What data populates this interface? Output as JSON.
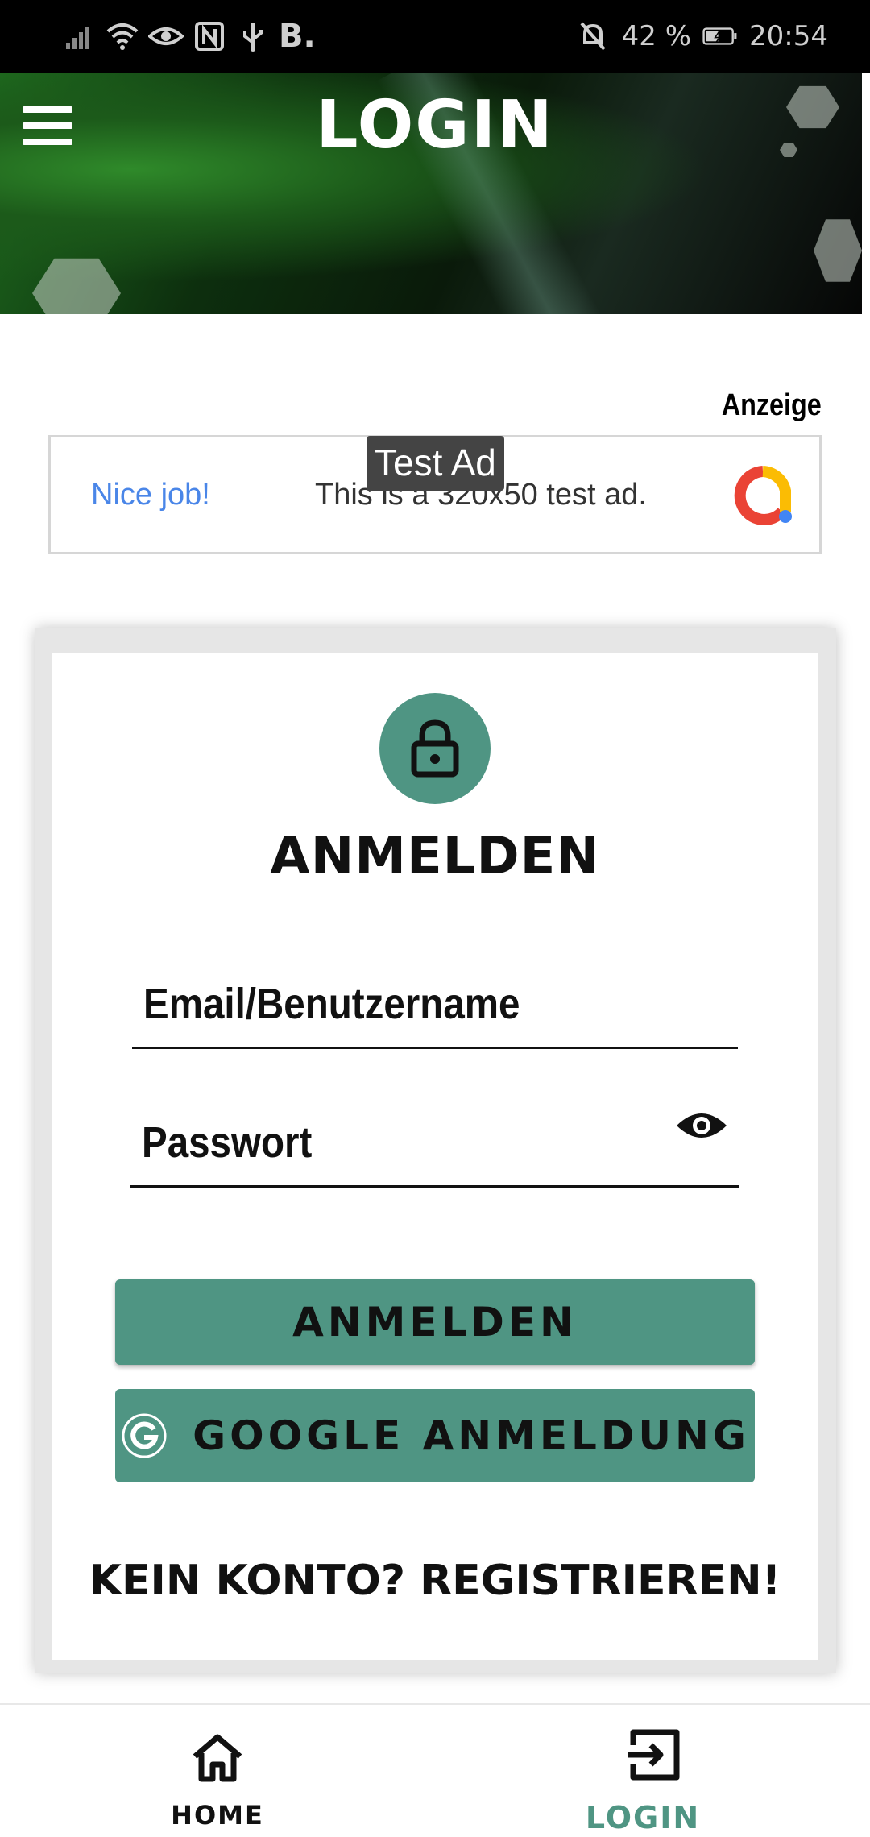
{
  "status_bar": {
    "carrier_badge": "B.",
    "battery": "42 %",
    "time": "20:54"
  },
  "header": {
    "title": "LOGIN"
  },
  "ad": {
    "label": "Anzeige",
    "tag": "Test Ad",
    "headline": "Nice job!",
    "body": "This is a 320x50 test ad."
  },
  "login_card": {
    "title": "ANMELDEN",
    "username_placeholder": "Email/Benutzername",
    "password_placeholder": "Passwort",
    "login_button": "ANMELDEN",
    "google_button": "GOOGLE ANMELDUNG",
    "register_link": "KEIN KONTO? REGISTRIEREN!"
  },
  "bottom_nav": {
    "items": [
      {
        "label": "HOME",
        "icon": "home-icon",
        "active": false
      },
      {
        "label": "LOGIN",
        "icon": "login-icon",
        "active": true
      }
    ]
  },
  "colors": {
    "accent": "#4f9583",
    "active_nav": "#4f9583",
    "ad_blue": "#4a86e8"
  }
}
